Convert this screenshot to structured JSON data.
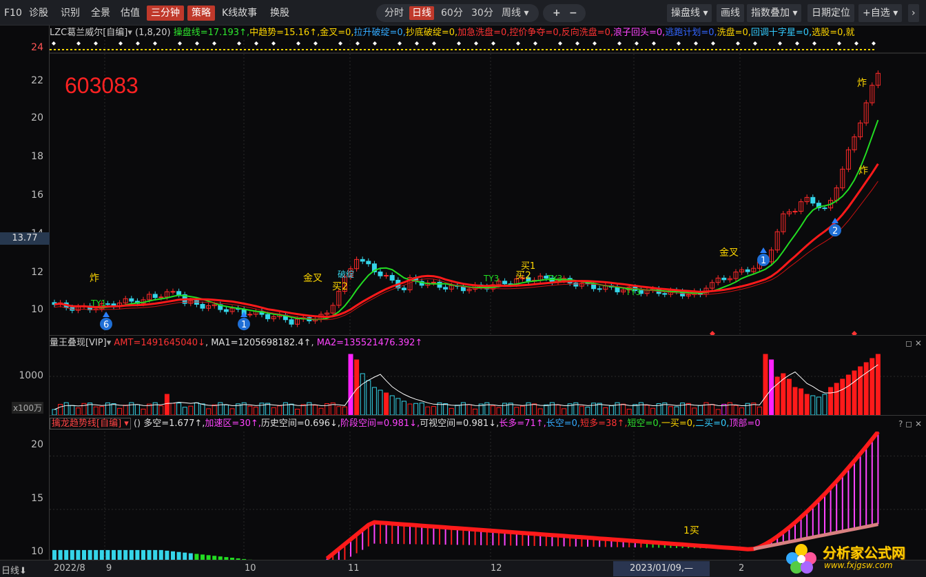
{
  "toolbar": {
    "items": [
      "F10",
      "诊股",
      "识别",
      "全景",
      "估值"
    ],
    "active_red": [
      "三分钟",
      "策略"
    ],
    "more": [
      "K线故事",
      "换股"
    ],
    "periods": [
      "分时",
      "日线",
      "60分",
      "30分",
      "周线"
    ],
    "period_active": "日线",
    "plus": "+",
    "minus": "−",
    "right": [
      "操盘线",
      "画线",
      "指数叠加",
      "日期定位",
      "+自选"
    ]
  },
  "main_panel": {
    "header_name": "LZC葛兰威尔[自编]",
    "header_params": "(1,8,20)",
    "indicators": [
      {
        "text": "操盘线=17.193↑",
        "color": "#2ee62e"
      },
      {
        "text": "中趋势=15.16↑",
        "color": "#ffd700"
      },
      {
        "text": "金叉=0",
        "color": "#ffd700"
      },
      {
        "text": "拉升破绽=0",
        "color": "#33aaff"
      },
      {
        "text": "抄底破绽=0",
        "color": "#ffd700"
      },
      {
        "text": "加急洗盘=0",
        "color": "#ff3333"
      },
      {
        "text": "控价争夺=0",
        "color": "#ff3333"
      },
      {
        "text": "反向洗盘=0",
        "color": "#ff3333"
      },
      {
        "text": "浪子回头=0",
        "color": "#ff44ff"
      },
      {
        "text": "逃跑计划=0",
        "color": "#3366ff"
      },
      {
        "text": "洗盘=0",
        "color": "#ffd700"
      },
      {
        "text": "回调十字星=0",
        "color": "#33ccff"
      },
      {
        "text": "选股=0",
        "color": "#ffd700"
      },
      {
        "text": "就",
        "color": "#ffd700"
      }
    ],
    "stock_code": "603083",
    "price_tag": "13.77",
    "y_labels": [
      "24",
      "22",
      "20",
      "18",
      "16",
      "14",
      "12",
      "10"
    ],
    "annotations": {
      "zha": "炸",
      "jincha": "金叉",
      "mai2": "买2",
      "ty3": "TY3",
      "mai1": "买1",
      "ty1": "TY1",
      "po": "破绽",
      "circle1": "1",
      "circle2": "2",
      "circle6": "6"
    }
  },
  "volume_panel": {
    "header_name": "量王叠现[VIP]",
    "amt": "AMT=1491645040↓",
    "ma1": "MA1=1205698182.4↑",
    "ma2": "MA2=135521476.392↑",
    "y_label": "1000",
    "unit": "x100万"
  },
  "trend_panel": {
    "header_name": "擒龙趋势线[自编]",
    "paren": "()",
    "items": [
      {
        "text": "多空=1.677↑",
        "color": "#e0e0e0"
      },
      {
        "text": "加速区=30↑",
        "color": "#ff44ff"
      },
      {
        "text": "历史空间=0.696↓",
        "color": "#e0e0e0"
      },
      {
        "text": "阶段空间=0.981↓",
        "color": "#ff44ff"
      },
      {
        "text": "可视空间=0.981↓",
        "color": "#e0e0e0"
      },
      {
        "text": "长多=71↑",
        "color": "#ff44ff"
      },
      {
        "text": "长空=0",
        "color": "#33aaff"
      },
      {
        "text": "短多=38↑",
        "color": "#ff3333"
      },
      {
        "text": "短空=0",
        "color": "#2ee62e"
      },
      {
        "text": "一买=0",
        "color": "#ffd700"
      },
      {
        "text": "二买=0",
        "color": "#33ccff"
      },
      {
        "text": "顶部=0",
        "color": "#ff44ff"
      }
    ],
    "y_labels": [
      "20",
      "15",
      "10"
    ],
    "annotation": "1买"
  },
  "bottom": {
    "period_label": "日线",
    "dates": [
      "2022/8",
      "9",
      "10",
      "11",
      "12",
      "2"
    ],
    "current_date": "2023/01/09,—"
  },
  "watermark": {
    "title": "分析家公式网",
    "url": "www.fxjgsw.com"
  },
  "colors": {
    "up": "#ff2a2a",
    "down": "#35d4e8",
    "ma_green": "#22dd22",
    "ma_red": "#ff1a1a",
    "yellow": "#ffd700"
  }
}
